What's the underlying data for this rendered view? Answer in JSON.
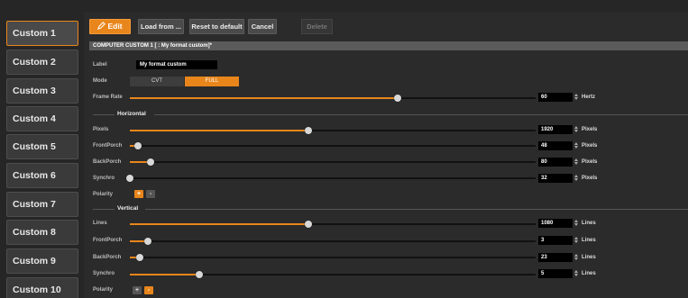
{
  "sidebar": {
    "items": [
      {
        "label": "Custom 1",
        "active": true
      },
      {
        "label": "Custom 2"
      },
      {
        "label": "Custom 3"
      },
      {
        "label": "Custom 4"
      },
      {
        "label": "Custom 5"
      },
      {
        "label": "Custom 6"
      },
      {
        "label": "Custom 7"
      },
      {
        "label": "Custom 8"
      },
      {
        "label": "Custom 9"
      },
      {
        "label": "Custom 10"
      }
    ]
  },
  "toolbar": {
    "edit_label": "Edit",
    "load_label": "Load from ...",
    "reset_label": "Reset to default",
    "cancel_label": "Cancel",
    "delete_label": "Delete"
  },
  "form": {
    "title": "COMPUTER CUSTOM 1 [ : My format custom]*",
    "label_caption": "Label",
    "label_value": "My format custom",
    "mode_caption": "Mode",
    "mode_options": [
      "CVT",
      "FULL"
    ],
    "mode_selected": "FULL",
    "frame_rate": {
      "caption": "Frame Rate",
      "value": "60",
      "unit": "Hertz",
      "level": 0.66
    },
    "horizontal": {
      "title": "Horizontal",
      "rows": [
        {
          "caption": "Pixels",
          "value": "1920",
          "unit": "Pixels",
          "level": 0.44
        },
        {
          "caption": "FrontPorch",
          "value": "48",
          "unit": "Pixels",
          "level": 0.02
        },
        {
          "caption": "BackPorch",
          "value": "80",
          "unit": "Pixels",
          "level": 0.05
        },
        {
          "caption": "Synchro",
          "value": "32",
          "unit": "Pixels",
          "level": 0.0
        }
      ],
      "polarity_caption": "Polarity",
      "polarity": {
        "plus": "+",
        "minus": "-",
        "selected": "+"
      }
    },
    "vertical": {
      "title": "Vertical",
      "rows": [
        {
          "caption": "Lines",
          "value": "1080",
          "unit": "Lines",
          "level": 0.44
        },
        {
          "caption": "FrontPorch",
          "value": "3",
          "unit": "Lines",
          "level": 0.045
        },
        {
          "caption": "BackPorch",
          "value": "23",
          "unit": "Lines",
          "level": 0.025
        },
        {
          "caption": "Synchro",
          "value": "5",
          "unit": "Lines",
          "level": 0.17
        }
      ],
      "polarity_caption": "Polarity",
      "polarity": {
        "plus": "+",
        "minus": "-",
        "selected": "-"
      }
    }
  },
  "colors": {
    "accent": "#e8861c",
    "background": "#2b2b2b",
    "sidebar_item": "#3a3a3a",
    "title_bar": "#5b5b5b",
    "input_bg": "#000000"
  }
}
